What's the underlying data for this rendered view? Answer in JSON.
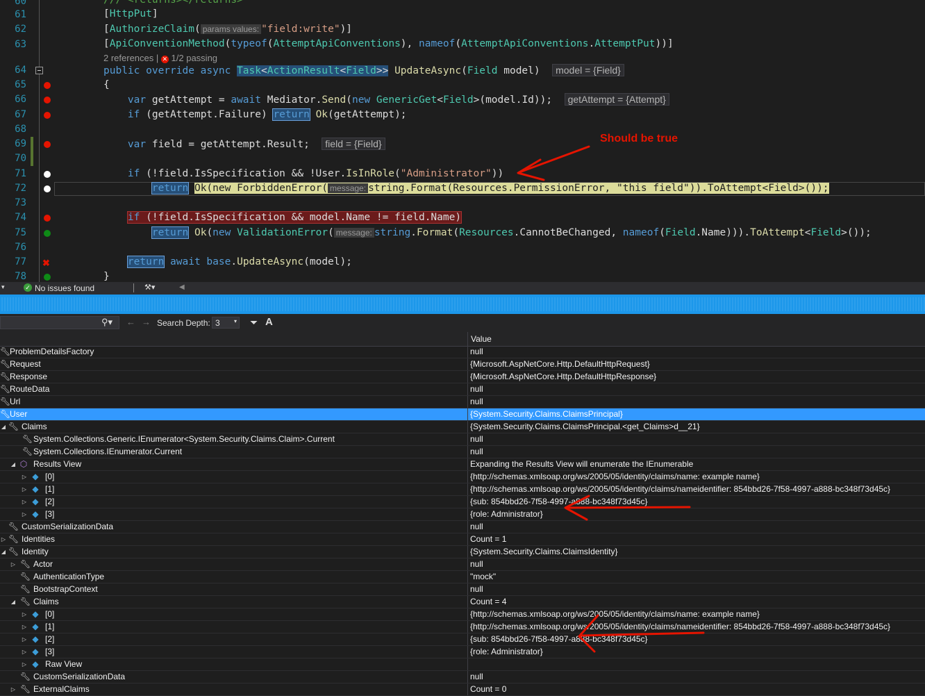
{
  "editor": {
    "line_numbers": [
      "60",
      "61",
      "62",
      "63",
      "64",
      "65",
      "66",
      "67",
      "68",
      "69",
      "70",
      "71",
      "72",
      "73",
      "74",
      "75",
      "76",
      "77",
      "78"
    ],
    "codelens": {
      "references": "2 references",
      "separator": "|",
      "passing": "1/2 passing"
    },
    "hints": {
      "model": "model = {Field}",
      "getAttempt": "getAttempt = {Attempt}",
      "field": "field = {Field}",
      "params_values": "params values:",
      "message": "message:"
    },
    "annotation": "Should be true",
    "annotation_color": "#e51400"
  },
  "editor_status": {
    "issues": "No issues found"
  },
  "toolbar": {
    "search_depth_label": "Search Depth:",
    "search_depth_value": "3"
  },
  "table": {
    "value_header": "Value",
    "rows": [
      {
        "name": "ProblemDetailsFactory",
        "value": "null"
      },
      {
        "name": "Request",
        "value": "{Microsoft.AspNetCore.Http.DefaultHttpRequest}"
      },
      {
        "name": "Response",
        "value": "{Microsoft.AspNetCore.Http.DefaultHttpResponse}"
      },
      {
        "name": "RouteData",
        "value": "null"
      },
      {
        "name": "Url",
        "value": "null"
      },
      {
        "name": "User",
        "value": "{System.Security.Claims.ClaimsPrincipal}"
      },
      {
        "name": "Claims",
        "value": "{System.Security.Claims.ClaimsPrincipal.<get_Claims>d__21}"
      },
      {
        "name": "System.Collections.Generic.IEnumerator<System.Security.Claims.Claim>.Current",
        "value": "null"
      },
      {
        "name": "System.Collections.IEnumerator.Current",
        "value": "null"
      },
      {
        "name": "Results View",
        "value": "Expanding the Results View will enumerate the IEnumerable"
      },
      {
        "name": "[0]",
        "value": "{http://schemas.xmlsoap.org/ws/2005/05/identity/claims/name: example name}"
      },
      {
        "name": "[1]",
        "value": "{http://schemas.xmlsoap.org/ws/2005/05/identity/claims/nameidentifier: 854bbd26-7f58-4997-a888-bc348f73d45c}"
      },
      {
        "name": "[2]",
        "value": "{sub: 854bbd26-7f58-4997-a888-bc348f73d45c}"
      },
      {
        "name": "[3]",
        "value": "{role: Administrator}"
      },
      {
        "name": "CustomSerializationData",
        "value": "null"
      },
      {
        "name": "Identities",
        "value": "Count = 1"
      },
      {
        "name": "Identity",
        "value": "{System.Security.Claims.ClaimsIdentity}"
      },
      {
        "name": "Actor",
        "value": "null"
      },
      {
        "name": "AuthenticationType",
        "value": "\"mock\""
      },
      {
        "name": "BootstrapContext",
        "value": "null"
      },
      {
        "name": "Claims",
        "value": "Count = 4"
      },
      {
        "name": "[0]",
        "value": "{http://schemas.xmlsoap.org/ws/2005/05/identity/claims/name: example name}"
      },
      {
        "name": "[1]",
        "value": "{http://schemas.xmlsoap.org/ws/2005/05/identity/claims/nameidentifier: 854bbd26-7f58-4997-a888-bc348f73d45c}"
      },
      {
        "name": "[2]",
        "value": "{sub: 854bbd26-7f58-4997-a888-bc348f73d45c}"
      },
      {
        "name": "[3]",
        "value": "{role: Administrator}"
      },
      {
        "name": "Raw View",
        "value": ""
      },
      {
        "name": "CustomSerializationData",
        "value": "null"
      },
      {
        "name": "ExternalClaims",
        "value": "Count = 0"
      }
    ]
  },
  "colors": {
    "selection": "#3399ff",
    "splitter": "#1c97ea",
    "arrow": "#e51400"
  }
}
